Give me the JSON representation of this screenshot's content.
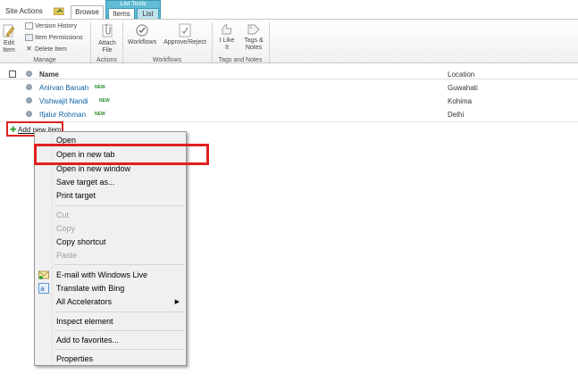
{
  "topbar": {
    "site_actions": "Site Actions",
    "tabs": {
      "browse": "Browse",
      "items": "Items",
      "list": "List"
    },
    "list_tools": "List Tools"
  },
  "ribbon": {
    "edit_item": "Edit Item",
    "version_history": "Version History",
    "item_permissions": "Item Permissions",
    "delete_item": "Delete Item",
    "attach_file": "Attach File",
    "workflows": "Workflows",
    "approve_reject": "Approve/Reject",
    "i_like_it": "I Like It",
    "tags_notes": "Tags & Notes",
    "groups": {
      "manage": "Manage",
      "actions": "Actions",
      "workflows": "Workflows",
      "tags_and_notes": "Tags and Notes"
    }
  },
  "list": {
    "columns": {
      "name": "Name",
      "location": "Location"
    },
    "new_badge": "NEW",
    "rows": [
      {
        "name": "Anirvan Baruah",
        "location": "Guwahati"
      },
      {
        "name": "Vishwajit Nandi",
        "location": "Kohima"
      },
      {
        "name": "Ifjalur Rohman",
        "location": "Delhi"
      }
    ],
    "add_new_item": "Add new item"
  },
  "context_menu": {
    "open": "Open",
    "open_new_tab": "Open in new tab",
    "open_new_window": "Open in new window",
    "save_target": "Save target as...",
    "print_target": "Print target",
    "cut": "Cut",
    "copy": "Copy",
    "copy_shortcut": "Copy shortcut",
    "paste": "Paste",
    "email_live": "E-mail with Windows Live",
    "translate_bing": "Translate with Bing",
    "all_accelerators": "All Accelerators",
    "inspect_element": "Inspect element",
    "add_favorites": "Add to favorites...",
    "properties": "Properties"
  },
  "colors": {
    "accent_red": "#e02020",
    "list_tools": "#5fbcd3",
    "link_blue": "#0c62a6",
    "new_green": "#2a8a2a"
  }
}
